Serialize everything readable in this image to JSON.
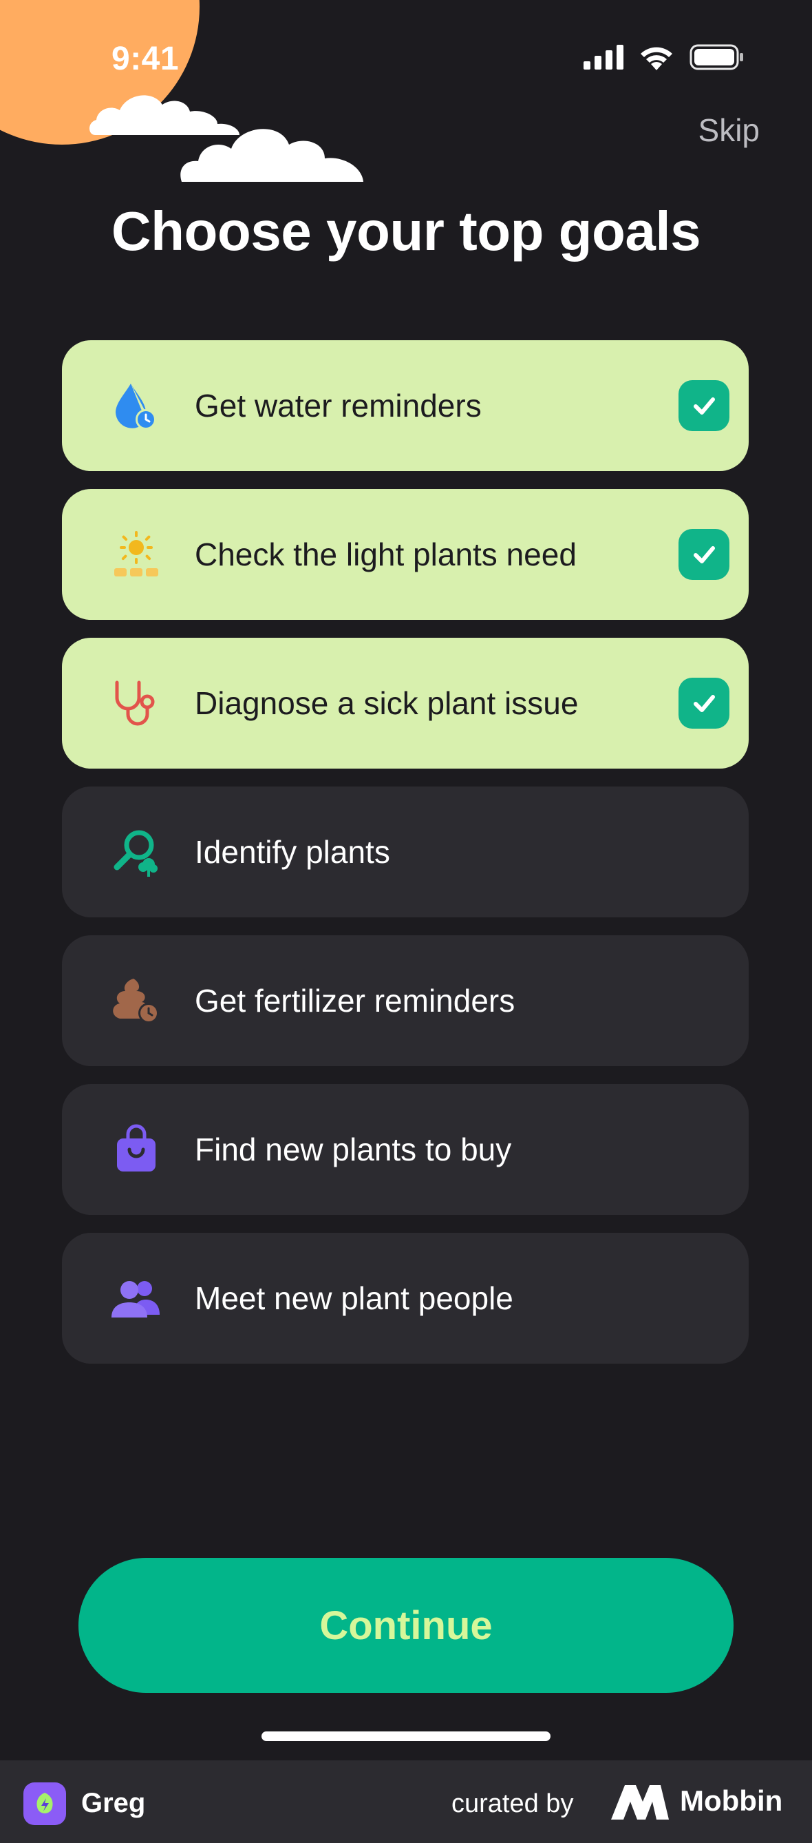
{
  "status_bar": {
    "time": "9:41"
  },
  "header": {
    "skip_label": "Skip",
    "title": "Choose your top goals"
  },
  "goals": [
    {
      "label": "Get water reminders",
      "icon": "water-drop-clock-icon",
      "selected": true
    },
    {
      "label": "Check the light plants need",
      "icon": "sun-icon",
      "selected": true
    },
    {
      "label": "Diagnose a sick plant issue",
      "icon": "stethoscope-icon",
      "selected": true
    },
    {
      "label": "Identify plants",
      "icon": "magnifier-plant-icon",
      "selected": false
    },
    {
      "label": "Get fertilizer reminders",
      "icon": "fertilizer-clock-icon",
      "selected": false
    },
    {
      "label": "Find new plants to buy",
      "icon": "shopping-bag-icon",
      "selected": false
    },
    {
      "label": "Meet new plant people",
      "icon": "people-icon",
      "selected": false
    }
  ],
  "continue_label": "Continue",
  "footer": {
    "app_name": "Greg",
    "curated_by": "curated by",
    "brand": "Mobbin"
  },
  "colors": {
    "background": "#1c1b1f",
    "card": "#2c2b30",
    "card_selected": "#d8f0ae",
    "accent": "#02b58a",
    "accent_text": "#d6f79a",
    "sun": "#ffac60"
  }
}
